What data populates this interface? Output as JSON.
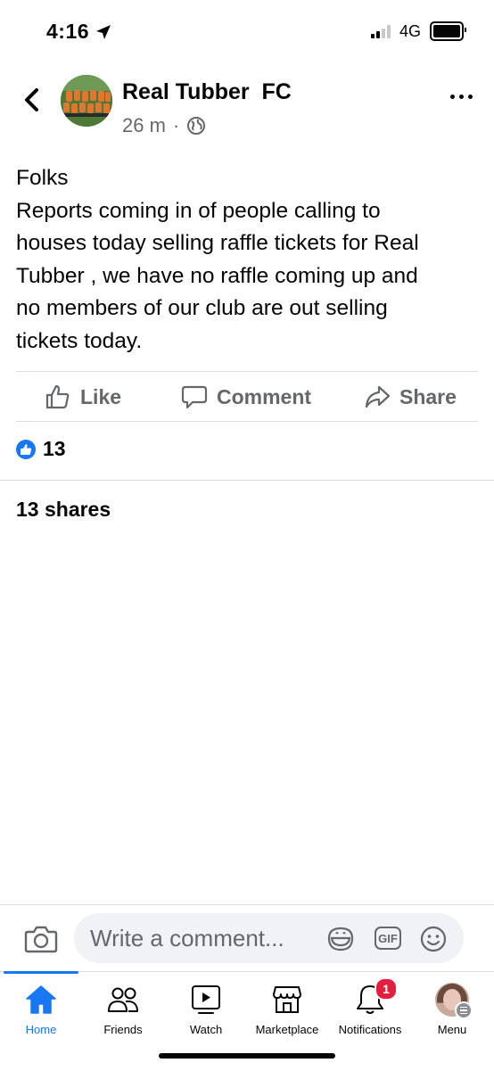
{
  "status_bar": {
    "time": "4:16",
    "network": "4G"
  },
  "post": {
    "page_name": "Real Tubber  FC",
    "time_ago": "26 m",
    "separator": "·",
    "text_lines": [
      "Folks",
      "Reports coming in of people calling to",
      "houses today selling raffle tickets for Real",
      "Tubber , we have no raffle coming up and",
      "no members of our club are out selling",
      "tickets today."
    ],
    "reaction_count": "13",
    "shares_text": "13 shares"
  },
  "actions": {
    "like": "Like",
    "comment": "Comment",
    "share": "Share"
  },
  "comment_bar": {
    "placeholder": "Write a comment...",
    "gif": "GIF"
  },
  "tabs": [
    {
      "label": "Home"
    },
    {
      "label": "Friends"
    },
    {
      "label": "Watch"
    },
    {
      "label": "Marketplace"
    },
    {
      "label": "Notifications",
      "badge": "1"
    },
    {
      "label": "Menu"
    }
  ],
  "colors": {
    "accent": "#1877f2",
    "secondary_text": "#65676b",
    "badge": "#e41e3f"
  },
  "icons": [
    "location-arrow-icon",
    "signal-icon",
    "battery-icon",
    "back-chevron-icon",
    "globe-icon",
    "more-icon",
    "like-icon",
    "comment-icon",
    "share-icon",
    "camera-icon",
    "sticker-icon",
    "gif-icon",
    "emoji-icon",
    "home-icon",
    "friends-icon",
    "watch-icon",
    "marketplace-icon",
    "bell-icon",
    "menu-icon"
  ]
}
